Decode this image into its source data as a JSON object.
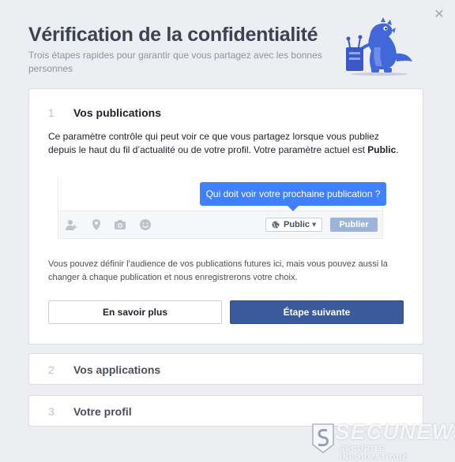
{
  "dialog": {
    "title": "Vérification de la confidentialité",
    "subtitle": "Trois étapes rapides pour garantir que vous partagez avec les bonnes personnes",
    "close_icon": "close-icon"
  },
  "steps": [
    {
      "number": "1",
      "title": "Vos publications",
      "description_prefix": "Ce paramètre contrôle qui peut voir ce que vous partagez lorsque vous publiez depuis le haut du fil d’actualité ou de votre profil. Votre paramètre actuel est ",
      "current_setting": "Public",
      "description_suffix": ".",
      "preview": {
        "tooltip": "Qui doit voir votre prochaine publication ?",
        "audience_label": "Public",
        "publish_label": "Publier",
        "icons": [
          "tag-person-icon",
          "location-pin-icon",
          "camera-icon",
          "smiley-icon",
          "globe-icon"
        ]
      },
      "note": "Vous pouvez définir l’audience de vos publications futures ici, mais vous pouvez aussi la changer à chaque publication et nous enregistrerons votre choix.",
      "learn_more_label": "En savoir plus",
      "next_label": "Étape suivante"
    },
    {
      "number": "2",
      "title": "Vos applications"
    },
    {
      "number": "3",
      "title": "Votre profil"
    }
  ],
  "watermark": {
    "title": "SECUNEWS",
    "subtitle": "SÉCURITÉ INFORMATIQUE"
  },
  "colors": {
    "background": "#eceef2",
    "primary_button": "#3b5a9b",
    "tooltip": "#4080ff",
    "publish_disabled": "#9cb4d8",
    "mascot": "#4267d9"
  }
}
